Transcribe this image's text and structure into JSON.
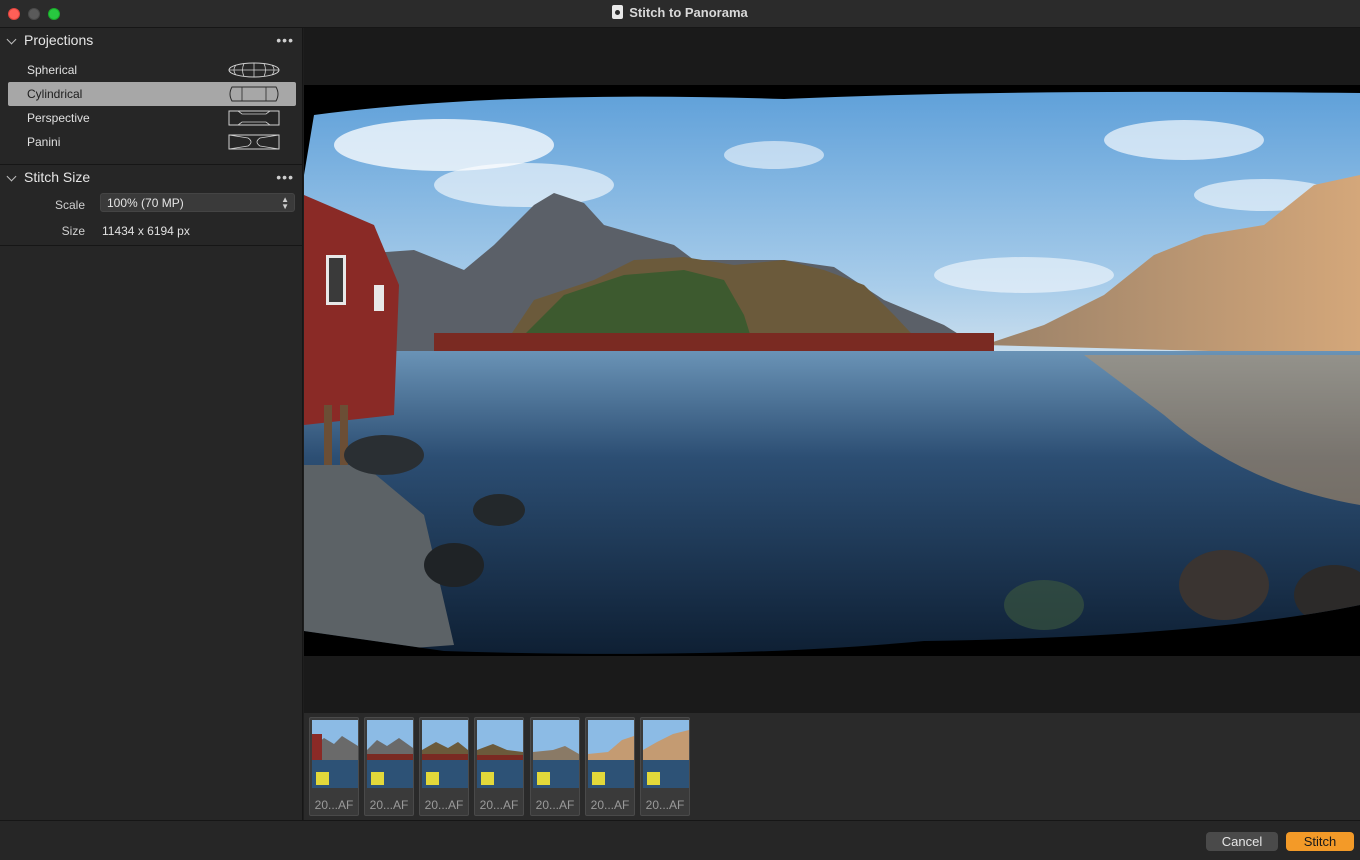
{
  "window": {
    "title": "Stitch to Panorama"
  },
  "projections": {
    "title": "Projections",
    "items": [
      {
        "label": "Spherical",
        "icon": "spherical-projection-icon",
        "selected": false
      },
      {
        "label": "Cylindrical",
        "icon": "cylindrical-projection-icon",
        "selected": true
      },
      {
        "label": "Perspective",
        "icon": "perspective-projection-icon",
        "selected": false
      },
      {
        "label": "Panini",
        "icon": "panini-projection-icon",
        "selected": false
      }
    ]
  },
  "stitch_size": {
    "title": "Stitch Size",
    "scale_label": "Scale",
    "scale_value": "100% (70 MP)",
    "size_label": "Size",
    "size_value": "11434 x 6194 px"
  },
  "filmstrip": {
    "thumbnails": [
      {
        "label": "20...AF"
      },
      {
        "label": "20...AF"
      },
      {
        "label": "20...AF"
      },
      {
        "label": "20...AF"
      },
      {
        "label": "20...AF"
      },
      {
        "label": "20...AF"
      },
      {
        "label": "20...AF"
      }
    ]
  },
  "actions": {
    "cancel_label": "Cancel",
    "stitch_label": "Stitch"
  },
  "colors": {
    "accent": "#f39a28",
    "selection": "#a7a7a7",
    "badge": "#e2d83a"
  }
}
